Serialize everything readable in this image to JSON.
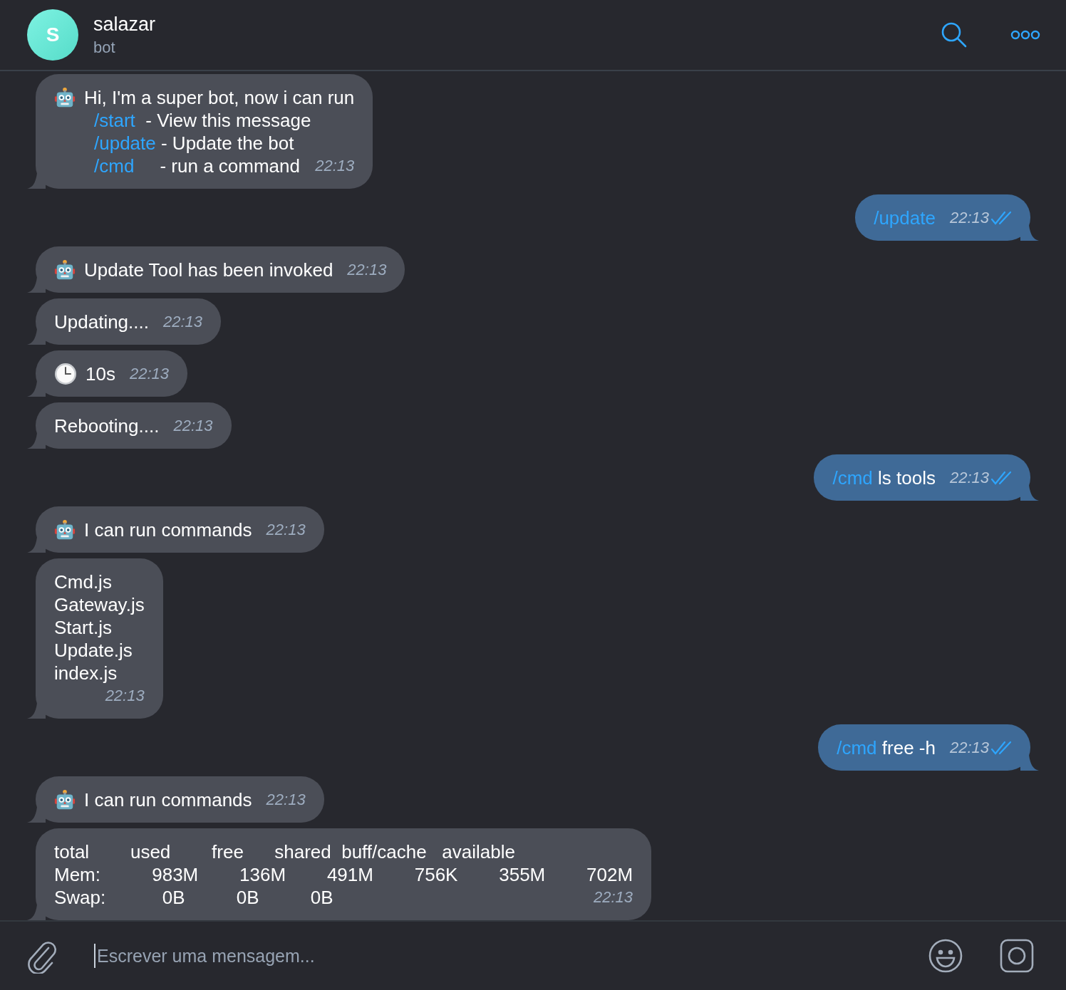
{
  "header": {
    "avatar_letter": "S",
    "title": "salazar",
    "subtitle": "bot"
  },
  "messages": [
    {
      "kind": "incoming",
      "lines": [
        {
          "kind": "robot",
          "text": "Hi, I'm a super bot, now i can run"
        },
        {
          "command": "/start",
          "text": "  - View this message"
        },
        {
          "command": "/update",
          "text": " - Update the bot"
        },
        {
          "command": "/cmd",
          "text": "     - run a command"
        }
      ],
      "time": "22:13"
    },
    {
      "kind": "outgoing",
      "lines": [
        {
          "command": "/update"
        }
      ],
      "time": "22:13",
      "read": true
    },
    {
      "kind": "incoming",
      "lines": [
        {
          "kind": "robot",
          "text": "Update Tool has been invoked"
        }
      ],
      "time": "22:13"
    },
    {
      "kind": "incoming",
      "lines": [
        {
          "text": "Updating...."
        }
      ],
      "time": "22:13"
    },
    {
      "kind": "incoming",
      "lines": [
        {
          "kind": "clock",
          "text": "10s"
        }
      ],
      "time": "22:13"
    },
    {
      "kind": "incoming",
      "lines": [
        {
          "text": "Rebooting...."
        }
      ],
      "time": "22:13"
    },
    {
      "kind": "outgoing",
      "lines": [
        {
          "command": "/cmd",
          "text": " ls tools"
        }
      ],
      "time": "22:13",
      "read": true
    },
    {
      "kind": "incoming",
      "lines": [
        {
          "kind": "robot",
          "text": "I can run commands"
        }
      ],
      "time": "22:13"
    },
    {
      "kind": "incoming",
      "lines": [
        {
          "text": "Cmd.js"
        },
        {
          "text": "Gateway.js"
        },
        {
          "text": "Start.js"
        },
        {
          "text": "Update.js"
        },
        {
          "text": "index.js"
        }
      ],
      "time": "22:13",
      "time_below": true
    },
    {
      "kind": "outgoing",
      "lines": [
        {
          "command": "/cmd",
          "text": " free -h"
        }
      ],
      "time": "22:13",
      "read": true
    },
    {
      "kind": "incoming",
      "lines": [
        {
          "kind": "robot",
          "text": "I can run commands"
        }
      ],
      "time": "22:13"
    },
    {
      "kind": "incoming",
      "lines": [
        {
          "text": "total        used        free      shared  buff/cache   available"
        },
        {
          "text": "Mem:          983M        136M        491M        756K        355M        702M"
        },
        {
          "text": "Swap:           0B          0B          0B"
        }
      ],
      "time": "22:13"
    }
  ],
  "composer": {
    "placeholder": "Escrever uma mensagem..."
  }
}
